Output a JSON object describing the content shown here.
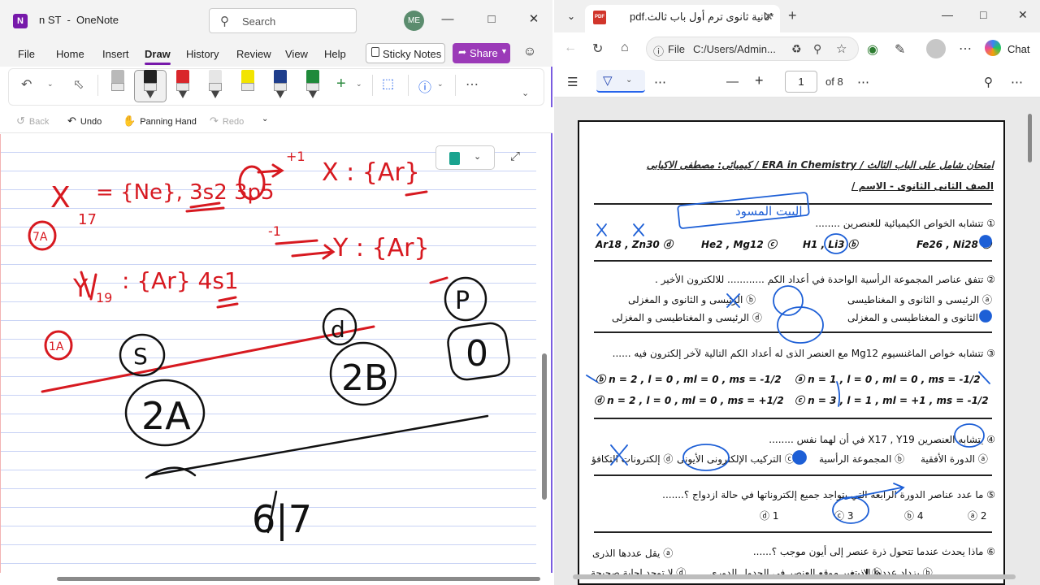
{
  "onenote": {
    "title": "n ST  -  OneNote",
    "logo": "N",
    "search_placeholder": "Search",
    "avatar_initials": "ME",
    "menu": [
      "File",
      "Home",
      "Insert",
      "Draw",
      "History",
      "Review",
      "View",
      "Help"
    ],
    "active_menu": "Draw",
    "sticky_notes": "Sticky Notes",
    "share": "Share",
    "quick": {
      "back": "Back",
      "undo": "Undo",
      "panning": "Panning Hand",
      "redo": "Redo"
    },
    "pen_colors": [
      "#b9b9b9",
      "#222222",
      "#d9262b",
      "#e6e6e6",
      "#f2e400",
      "#1f3e8c",
      "#1f8a3a"
    ],
    "handwriting": {
      "line1_left": "X",
      "line1_sub": "17",
      "line1_mid": "= {Ne}, 3s2 3p5",
      "line1_sup": "+1",
      "line1_right": "X : {Ar}",
      "circle_a": "7A",
      "line2_left": "Y",
      "line2_sub": "19",
      "line2_mid": ": {Ar} 4s1",
      "line2_sup": "-1",
      "line2_right": "Y : {Ar}",
      "circle_b": "1A",
      "s_label": "S",
      "d_label": "d",
      "p_label": "P",
      "o_label": "0",
      "label_2a": "2A",
      "label_2b": "2B",
      "fraction": "6|7"
    }
  },
  "edge": {
    "tab_title": "*ثانية ثانوى ترم أول باب ثالث.pdf",
    "address_label": "File",
    "url": "C:/Users/Admin...",
    "chat": "Chat",
    "page_number": "1",
    "page_of": "of 8",
    "accent": "#2563eb"
  },
  "pdf": {
    "header_line": "امتحان شامل على الباب الثالث  /  ERA in Chemistry  /  كيميائى: مصطفى الاكيابى",
    "header_line2": "الصف الثانى الثانوى  -  الاسم /",
    "annotation_top": "البيت المسود",
    "q1": "① تتشابه الخواص الكيميائية للعنصرين ........",
    "q1_opts": [
      "Fe26 , Ni28 ⓐ",
      "H1 , Li3 ⓑ",
      "He2 , Mg12 ⓒ",
      "Ar18 , Zn30 ⓓ"
    ],
    "q2": "② تتفق عناصر المجموعة الرأسية الواحدة في أعداد الكم ............ للالكترون الأخير .",
    "q2_opts": [
      "ⓐ الرئيسى و الثانوى و المغناطيسى",
      "ⓑ الرئيسى و الثانوى و المغزلى",
      "ⓒ الثانوى و المغناطيسى و المغزلى",
      "ⓓ الرئيسى و المغناطيسى و المغزلى"
    ],
    "q3": "③ تتشابه خواص الماغنسيوم Mg12 مع العنصر الذى له أعداد الكم التالية لآخر إلكترون فيه  ......",
    "q3_opts": [
      "ⓐ n = 1 , l = 0 , ml = 0 , ms = -1/2",
      "ⓑ n = 2 , l = 0 , ml = 0 , ms = -1/2",
      "ⓒ n = 3 , l = 1 , ml = +1 , ms = -1/2",
      "ⓓ n = 2 , l = 0 , ml = 0 , ms = +1/2"
    ],
    "q4": "④ يتشابه العنصرين X17 , Y19 في أن لهما نفس ........",
    "q4_opts": [
      "ⓐ الدورة الأفقية",
      "ⓑ المجموعة الرأسية",
      "ⓒ التركيب الإلكترونى الأيونى",
      "ⓓ إلكترونات التكافؤ"
    ],
    "q5": "⑤ ما عدد عناصر الدورة الرابعة التي يتواجد جميع إلكتروناتها في حالة ازدواج ؟.......",
    "q5_opts": [
      "ⓐ 2",
      "ⓑ 4",
      "ⓒ 3",
      "ⓓ 1"
    ],
    "q6": "⑥ ماذا يحدث عندما تتحول ذرة عنصر إلى أيون موجب ؟......",
    "q6_opts": [
      "ⓐ يقل عددها الذرى",
      "ⓑ يزداد عددها الذرى",
      "ⓒ لا يتغير موقع العنصر في الجدول الدورى",
      "ⓓ لا توجد إجابة صحيحة"
    ]
  }
}
